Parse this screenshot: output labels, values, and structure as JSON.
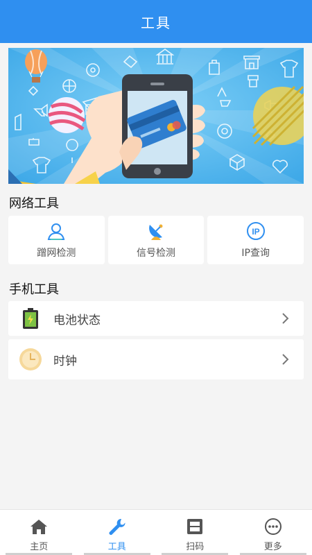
{
  "header": {
    "title": "工具"
  },
  "network_section": {
    "title": "网络工具",
    "items": [
      {
        "label": "蹭网检测",
        "icon": "person-search-icon"
      },
      {
        "label": "信号检测",
        "icon": "satellite-dish-icon"
      },
      {
        "label": "IP查询",
        "icon": "ip-icon"
      }
    ]
  },
  "phone_section": {
    "title": "手机工具",
    "items": [
      {
        "label": "电池状态",
        "icon": "battery-icon"
      },
      {
        "label": "时钟",
        "icon": "clock-icon"
      }
    ]
  },
  "tabbar": {
    "tabs": [
      {
        "label": "主页",
        "icon": "home-icon"
      },
      {
        "label": "工具",
        "icon": "wrench-icon",
        "active": true
      },
      {
        "label": "扫码",
        "icon": "scan-icon"
      },
      {
        "label": "更多",
        "icon": "more-icon"
      }
    ]
  },
  "colors": {
    "primary": "#2f8ff0",
    "banner": "#52b8ef",
    "battery": "#7ec244",
    "clock": "#f6d89a"
  }
}
